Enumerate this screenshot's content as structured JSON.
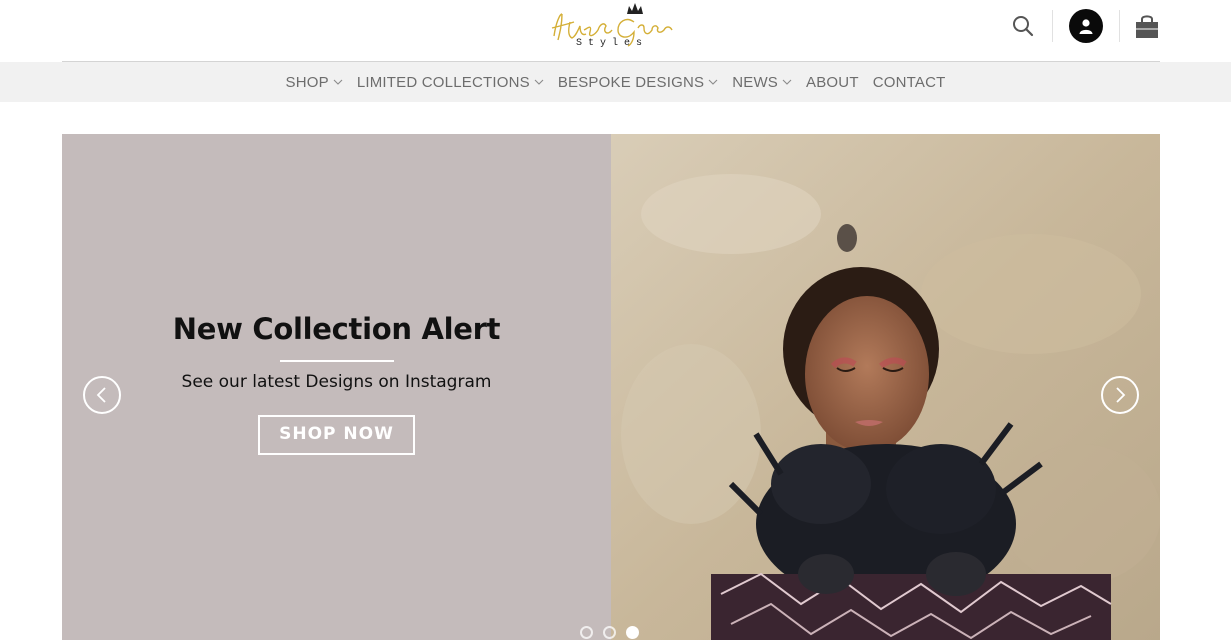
{
  "logo": {
    "script_text": "Hazel Grace",
    "subtitle": "Styles"
  },
  "header": {
    "icons": [
      "search-icon",
      "user-icon",
      "shopping-bag-icon"
    ]
  },
  "nav": {
    "items": [
      {
        "label": "SHOP",
        "dropdown": true
      },
      {
        "label": "LIMITED COLLECTIONS",
        "dropdown": true
      },
      {
        "label": "BESPOKE DESIGNS",
        "dropdown": true
      },
      {
        "label": "NEWS",
        "dropdown": true
      },
      {
        "label": "ABOUT",
        "dropdown": false
      },
      {
        "label": "CONTACT",
        "dropdown": false
      }
    ]
  },
  "slider": {
    "title": "New Collection Alert",
    "subtitle": "See our latest Designs on Instagram",
    "button": "SHOP NOW",
    "slide_count": 3,
    "active_slide": 3
  },
  "colors": {
    "slide_bg": "#c4bbbb",
    "nav_bg": "#f1f1f1",
    "nav_text": "#6d6d6d",
    "logo_gold": "#d4af37"
  }
}
